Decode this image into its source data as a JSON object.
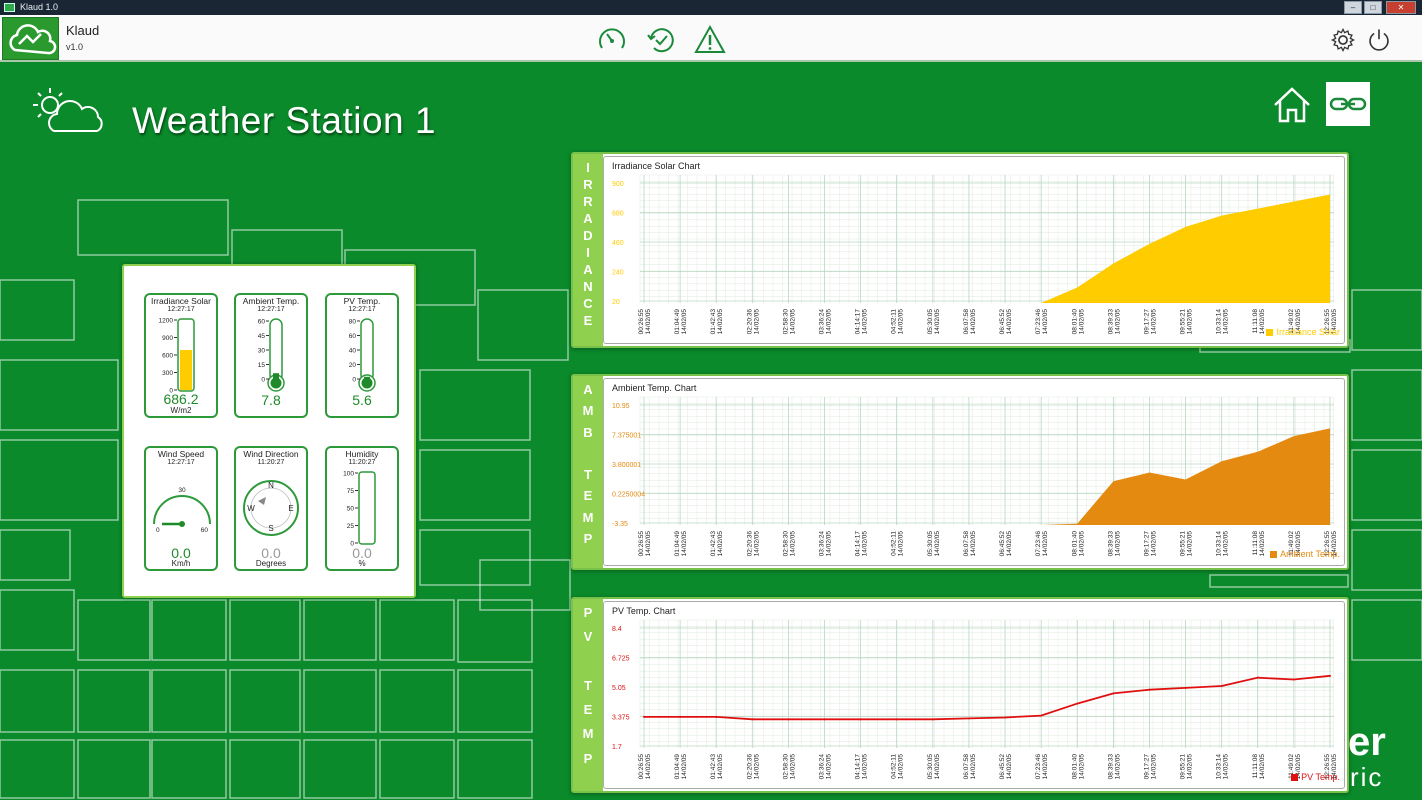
{
  "window": {
    "title": "Klaud 1.0"
  },
  "app": {
    "name": "Klaud",
    "version": "v1.0"
  },
  "toolbar": {
    "icons": [
      "speedometer-icon",
      "history-check-icon",
      "warning-icon",
      "settings-gear-icon",
      "power-icon"
    ]
  },
  "page": {
    "title": "Weather Station 1"
  },
  "sensors": [
    {
      "title": "Irradiance Solar",
      "time": "12:27:17",
      "value": "686.2",
      "unit": "W/m2",
      "type": "bar",
      "ticks": [
        "1200",
        "900",
        "600",
        "300",
        "0"
      ],
      "level": 0.572
    },
    {
      "title": "Ambient Temp.",
      "time": "12:27:17",
      "value": "7.8",
      "unit": "",
      "type": "thermometer",
      "ticks": [
        "60",
        "45",
        "30",
        "15",
        "0"
      ],
      "level": 0.13
    },
    {
      "title": "PV Temp.",
      "time": "12:27:17",
      "value": "5.6",
      "unit": "",
      "type": "thermometer",
      "ticks": [
        "80",
        "60",
        "40",
        "20",
        "0"
      ],
      "level": 0.07
    },
    {
      "title": "Wind Speed",
      "time": "12:27:17",
      "value": "0.0",
      "unit": "Km/h",
      "type": "gauge",
      "ticks": [
        "0",
        "30",
        "60"
      ],
      "level": 0
    },
    {
      "title": "Wind Direction",
      "time": "11:20:27",
      "value": "0.0",
      "unit": "Degrees",
      "type": "compass",
      "ticks": [
        "N",
        "E",
        "S",
        "W"
      ],
      "level": 0
    },
    {
      "title": "Humidity",
      "time": "11:20:27",
      "value": "0.0",
      "unit": "%",
      "type": "bar",
      "ticks": [
        "100",
        "75",
        "50",
        "25",
        "0"
      ],
      "level": 0
    }
  ],
  "timestamps": [
    "00:26:55",
    "01:04:49",
    "01:42:43",
    "02:20:36",
    "02:58:30",
    "03:36:24",
    "04:14:17",
    "04:52:11",
    "05:30:05",
    "06:07:58",
    "06:45:52",
    "07:23:46",
    "08:01:40",
    "08:39:33",
    "09:17:27",
    "09:55:21",
    "10:33:14",
    "11:11:08",
    "11:49:02",
    "12:26:55"
  ],
  "date_label": "14/02/05",
  "colors": {
    "irradiance": "#ffcc00",
    "ambient": "#e58a10",
    "pv": "#e01010",
    "tab": "#8fd04e",
    "bg": "#0a8a2a"
  },
  "chart_data": [
    {
      "type": "area",
      "title": "Irradiance Solar Chart",
      "tab_label": "IRRADIANCE",
      "y_ticks": [
        "900",
        "680",
        "460",
        "240",
        "20"
      ],
      "ylim": [
        20,
        900
      ],
      "series": [
        {
          "name": "Irradiance Solar",
          "values": [
            20,
            20,
            20,
            20,
            20,
            20,
            20,
            20,
            20,
            20,
            20,
            20,
            130,
            300,
            440,
            560,
            640,
            690,
            740,
            790
          ]
        }
      ]
    },
    {
      "type": "area",
      "title": "Ambient Temp. Chart",
      "tab_label": "AMB TEMP",
      "y_ticks": [
        "10.95",
        "7.375001",
        "3.800001",
        "0.2250004",
        "-3.35"
      ],
      "ylim": [
        -3.35,
        10.95
      ],
      "series": [
        {
          "name": "Ambient Temp.",
          "values": [
            -3.35,
            -3.35,
            -3.35,
            -3.35,
            -3.35,
            -3.35,
            -3.35,
            -3.35,
            -3.35,
            -3.35,
            -3.35,
            -3.35,
            -3.2,
            1.7,
            2.7,
            1.9,
            4.0,
            5.1,
            6.9,
            7.8
          ]
        }
      ]
    },
    {
      "type": "line",
      "title": "PV Temp. Chart",
      "tab_label": "PV TEMP",
      "y_ticks": [
        "8.4",
        "6.725",
        "5.05",
        "3.375",
        "1.7"
      ],
      "ylim": [
        1.7,
        8.4
      ],
      "series": [
        {
          "name": "PV Temp.",
          "values": [
            3.38,
            3.38,
            3.38,
            3.25,
            3.25,
            3.25,
            3.25,
            3.25,
            3.25,
            3.3,
            3.35,
            3.45,
            4.1,
            4.65,
            4.85,
            4.95,
            5.05,
            5.5,
            5.4,
            5.6
          ]
        }
      ]
    }
  ],
  "brand": {
    "line1": "er",
    "line2": "ric"
  }
}
